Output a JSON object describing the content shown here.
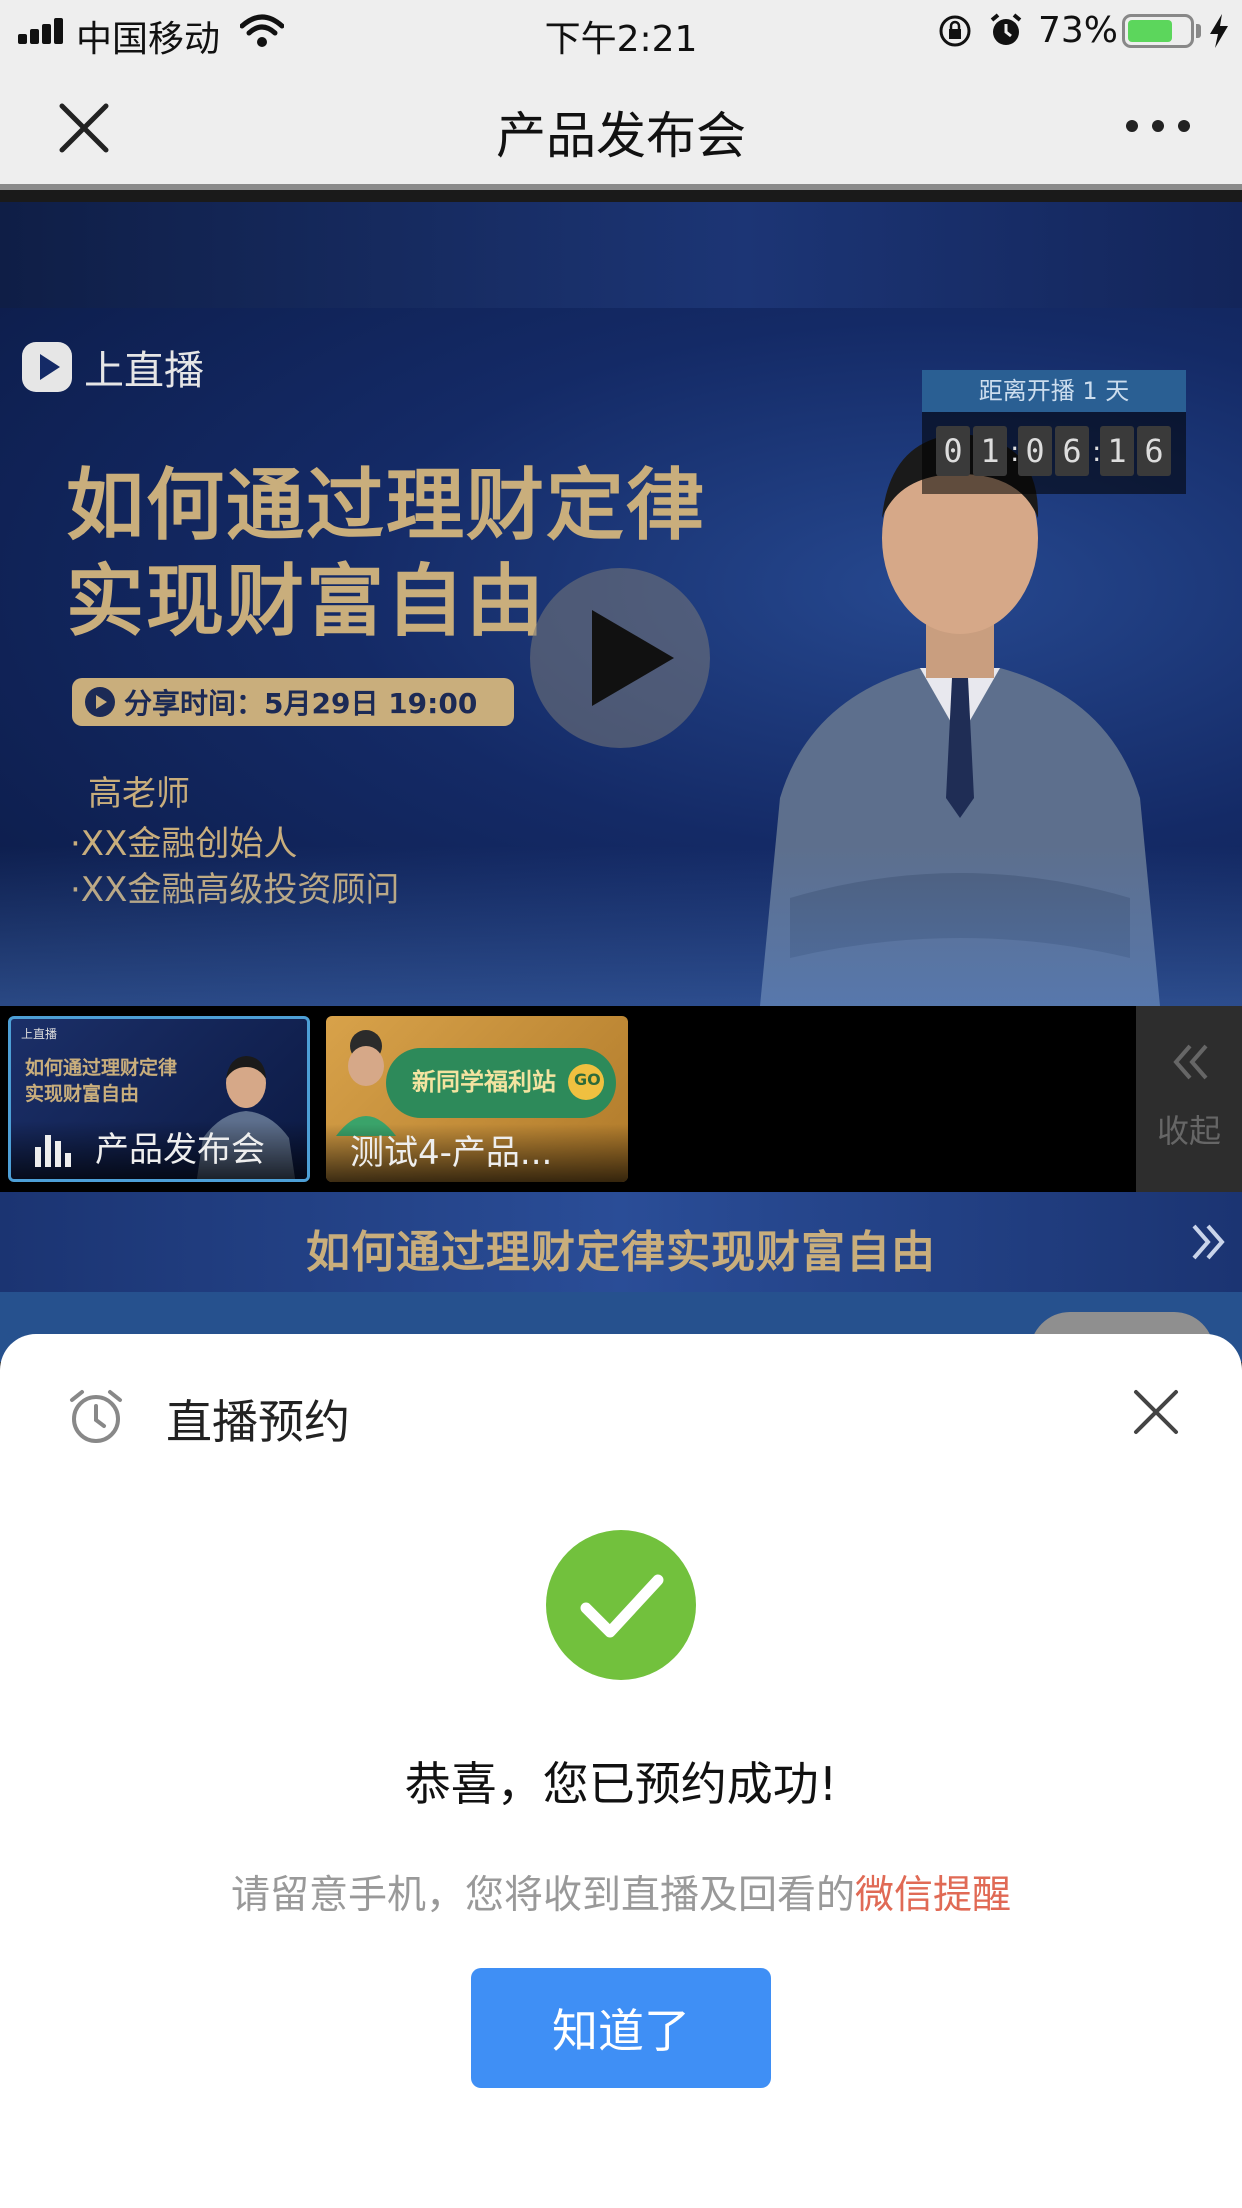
{
  "status_bar": {
    "carrier": "中国移动",
    "time": "下午2:21",
    "battery_percent": "73%",
    "battery_level": 0.73
  },
  "nav": {
    "title": "产品发布会",
    "close_icon": "close-icon",
    "more_icon": "more-icon"
  },
  "video": {
    "brand": "上直播",
    "headline_line1": "如何通过理财定律",
    "headline_line2": "实现财富自由",
    "share_time": "分享时间：5月29日 19:00",
    "teacher": "高老师",
    "bullet1": "·XX金融创始人",
    "bullet2": "·XX金融高级投资顾问",
    "countdown_label": "距离开播 1 天",
    "countdown_digits": [
      "0",
      "1",
      "0",
      "6",
      "1",
      "6"
    ],
    "play_icon": "play-icon"
  },
  "playlist": {
    "items": [
      {
        "title": "产品发布会",
        "mini_brand": "上直播",
        "mini_headline1": "如何通过理财定律",
        "mini_headline2": "实现财富自由"
      },
      {
        "title": "测试4-产品...",
        "mini_headline": "新同学福利站",
        "mini_badge": "GO"
      }
    ],
    "collapse_label": "收起"
  },
  "title_banner": {
    "text": "如何通过理财定律实现财富自由"
  },
  "modal": {
    "title": "直播预约",
    "message": "恭喜，您已预约成功!",
    "sub_prefix": "请留意手机，您将收到直播及回看的",
    "sub_link": "微信提醒",
    "button": "知道了"
  },
  "colors": {
    "accent_blue": "#3f8ff5",
    "success_green": "#72c13d",
    "link_red": "#e06a55",
    "gold": "#c9ae7c"
  }
}
